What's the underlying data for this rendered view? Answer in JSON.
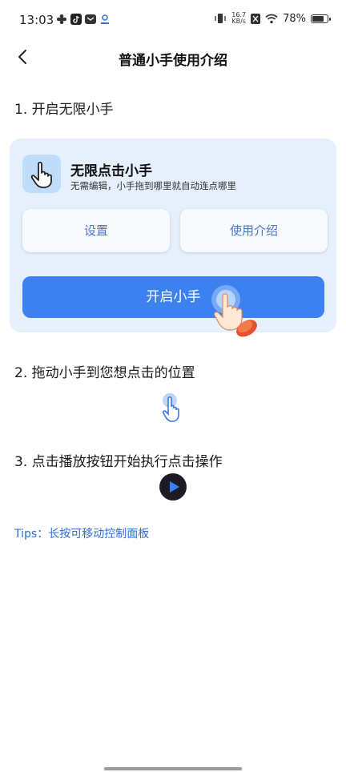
{
  "status_bar": {
    "time": "13:03",
    "net_speed_value": "16.7",
    "net_speed_unit": "KB/s",
    "battery_percent": "78%",
    "battery_level": 0.78
  },
  "header": {
    "title": "普通小手使用介绍"
  },
  "steps": {
    "step1": "1. 开启无限小手",
    "step2": "2. 拖动小手到您想点击的位置",
    "step3": "3. 点击播放按钮开始执行点击操作"
  },
  "card": {
    "app_name": "无限点击小手",
    "app_desc": "无需编辑，小手拖到哪里就自动连点哪里",
    "settings_label": "设置",
    "intro_label": "使用介绍",
    "start_label": "开启小手"
  },
  "tips": "Tips：长按可移动控制面板",
  "colors": {
    "accent": "#3d80f0",
    "card_bg": "#e6f0fd",
    "link": "#2d6fd3"
  }
}
